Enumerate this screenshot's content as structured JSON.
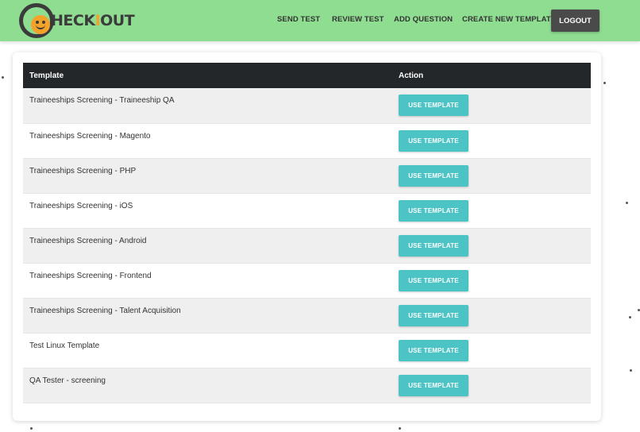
{
  "brand": {
    "logo_prefix": "HECK",
    "logo_mid": "I",
    "logo_suffix": "OUT"
  },
  "nav": {
    "send_test": "SEND TEST",
    "review_test": "REVIEW TEST",
    "add_question": "ADD QUESTION",
    "create_new_template": "CREATE NEW TEMPLATE",
    "logout": "LOGOUT"
  },
  "table": {
    "headers": {
      "template": "Template",
      "action": "Action"
    },
    "rows": [
      {
        "name": "Traineeships Screening - Traineeship QA",
        "button": "USE TEMPLATE"
      },
      {
        "name": "Traineeships Screening - Magento",
        "button": "USE TEMPLATE"
      },
      {
        "name": "Traineeships Screening - PHP",
        "button": "USE TEMPLATE"
      },
      {
        "name": "Traineeships Screening - iOS",
        "button": "USE TEMPLATE"
      },
      {
        "name": "Traineeships Screening - Android",
        "button": "USE TEMPLATE"
      },
      {
        "name": "Traineeships Screening - Frontend",
        "button": "USE TEMPLATE"
      },
      {
        "name": "Traineeships Screening - Talent Acquisition",
        "button": "USE TEMPLATE"
      },
      {
        "name": "Test Linux Template",
        "button": "USE TEMPLATE"
      },
      {
        "name": "QA Tester - screening",
        "button": "USE TEMPLATE"
      }
    ]
  },
  "colors": {
    "navbar": "#8fdd91",
    "header_row": "#23272a",
    "button": "#4cc4c6",
    "logout": "#4a4a4a",
    "logo_accent": "#f4a32a"
  },
  "icons": {
    "logo": "checkout-smiley-logo-icon"
  }
}
